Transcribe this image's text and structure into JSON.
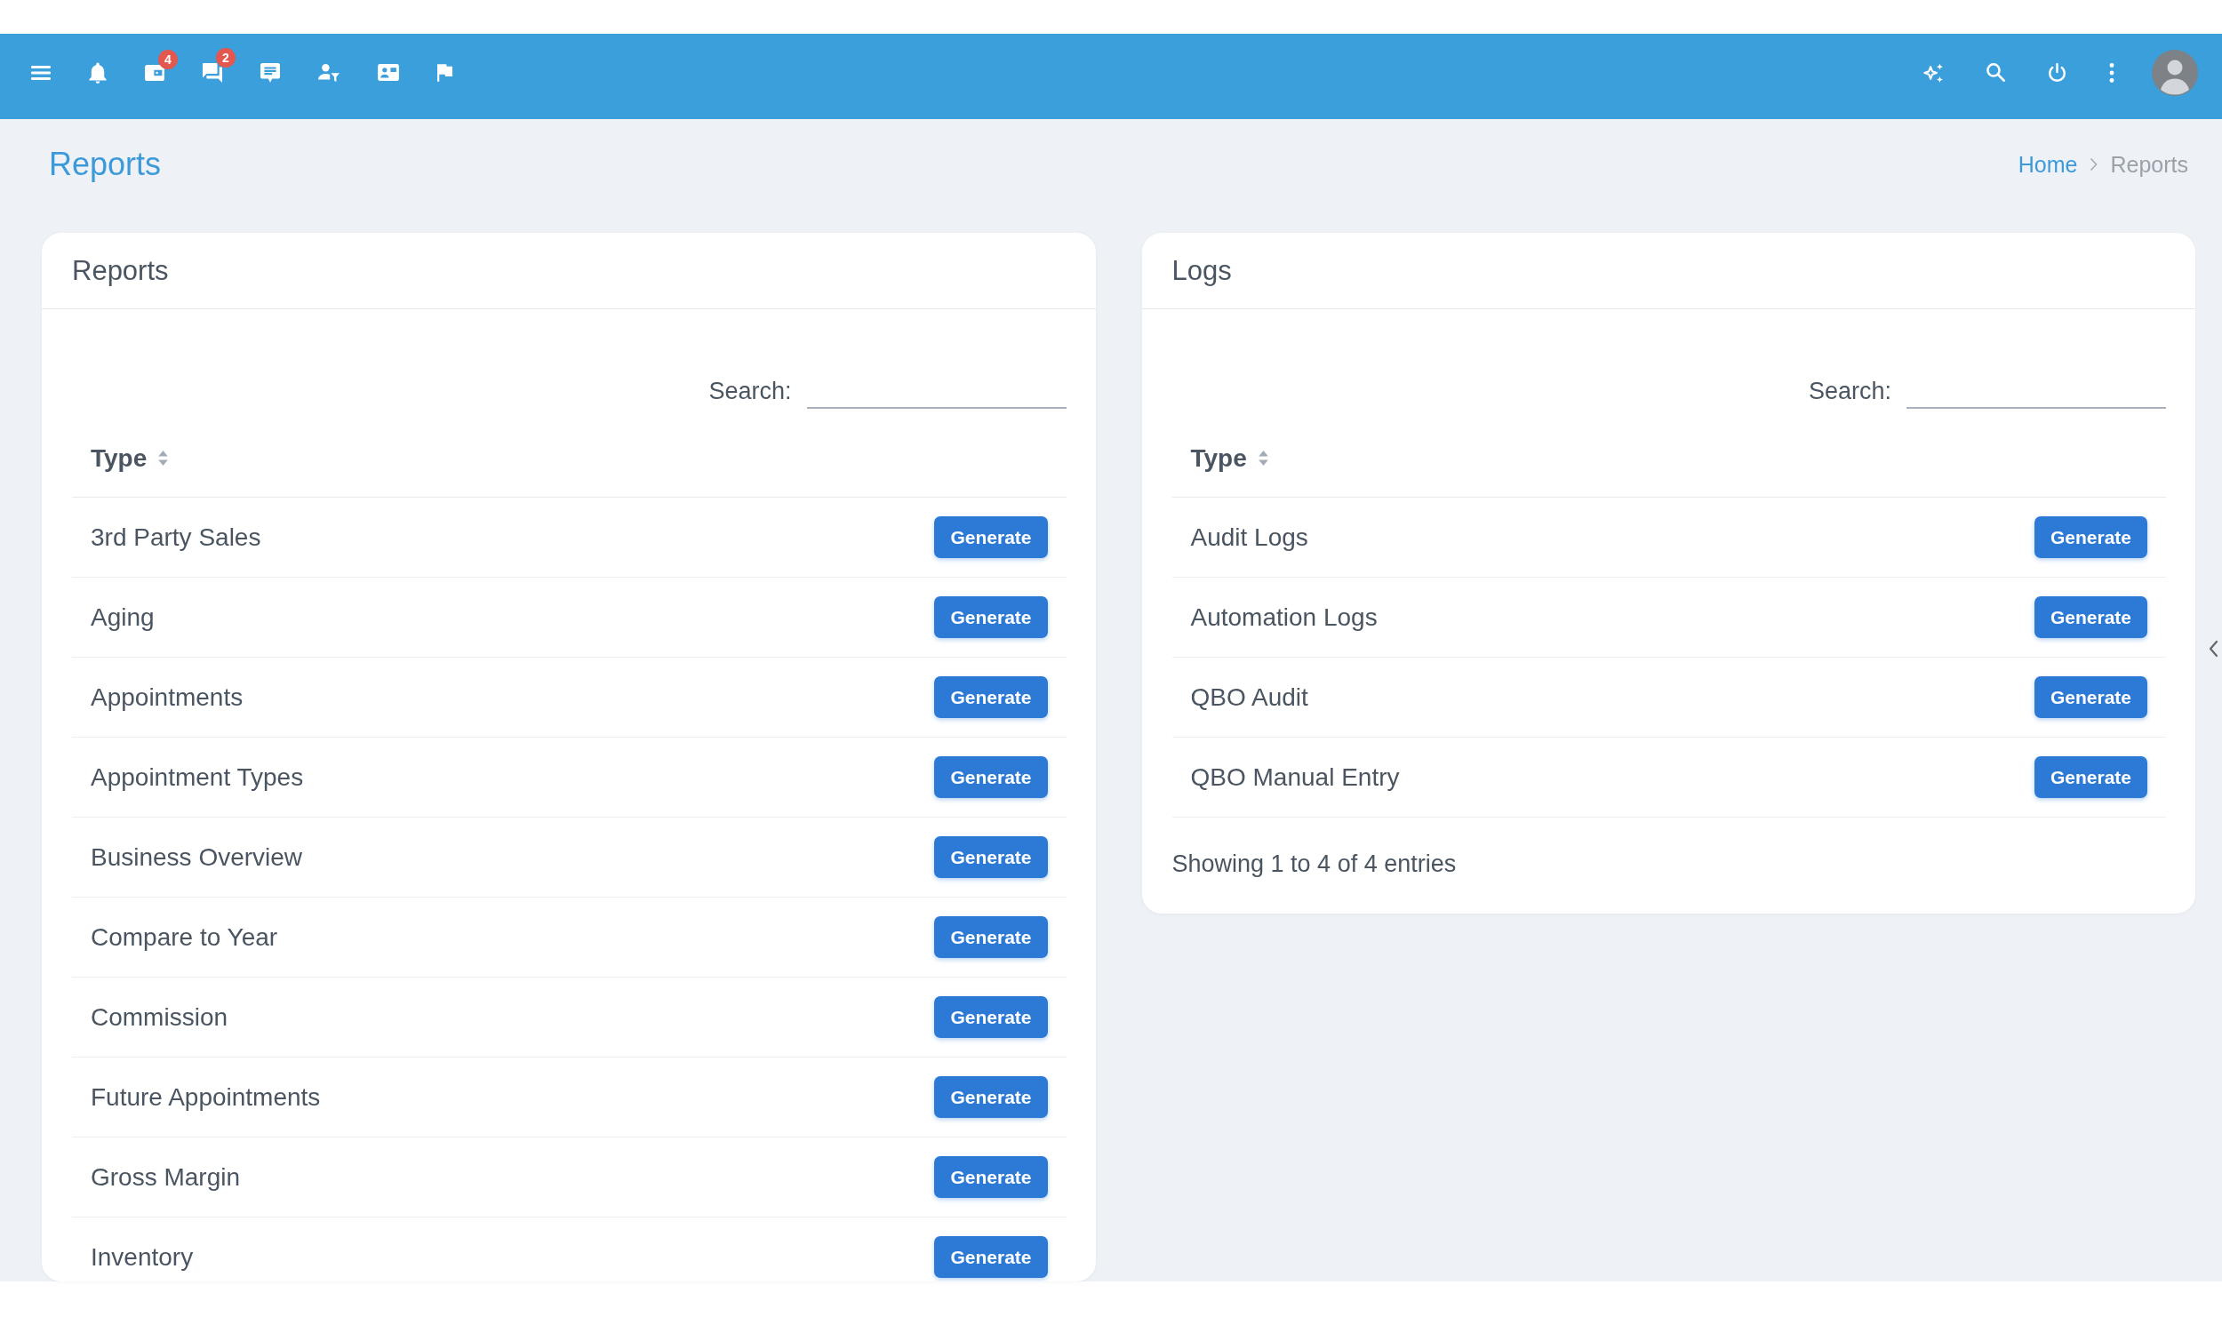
{
  "navbar": {
    "notification_counts": [
      "4",
      "2"
    ]
  },
  "page": {
    "title": "Reports",
    "breadcrumb": [
      {
        "label": "Home",
        "current": false
      },
      {
        "label": "Reports",
        "current": true
      }
    ]
  },
  "panels": [
    {
      "title": "Reports",
      "search": {
        "label": "Search:"
      },
      "table": {
        "columns": [
          {
            "label": "Type",
            "sortable": true
          }
        ],
        "rows": [
          {
            "type": "3rd Party Sales",
            "action": "Generate"
          },
          {
            "type": "Aging",
            "action": "Generate"
          },
          {
            "type": "Appointments",
            "action": "Generate"
          },
          {
            "type": "Appointment Types",
            "action": "Generate"
          },
          {
            "type": "Business Overview",
            "action": "Generate"
          },
          {
            "type": "Compare to Year",
            "action": "Generate"
          },
          {
            "type": "Commission",
            "action": "Generate"
          },
          {
            "type": "Future Appointments",
            "action": "Generate"
          },
          {
            "type": "Gross Margin",
            "action": "Generate"
          },
          {
            "type": "Inventory",
            "action": "Generate"
          }
        ]
      }
    },
    {
      "title": "Logs",
      "search": {
        "label": "Search:"
      },
      "table": {
        "columns": [
          {
            "label": "Type",
            "sortable": true
          }
        ],
        "rows": [
          {
            "type": "Audit Logs",
            "action": "Generate"
          },
          {
            "type": "Automation Logs",
            "action": "Generate"
          },
          {
            "type": "QBO Audit",
            "action": "Generate"
          },
          {
            "type": "QBO Manual Entry",
            "action": "Generate"
          }
        ]
      },
      "info": "Showing 1 to 4 of 4 entries"
    }
  ]
}
